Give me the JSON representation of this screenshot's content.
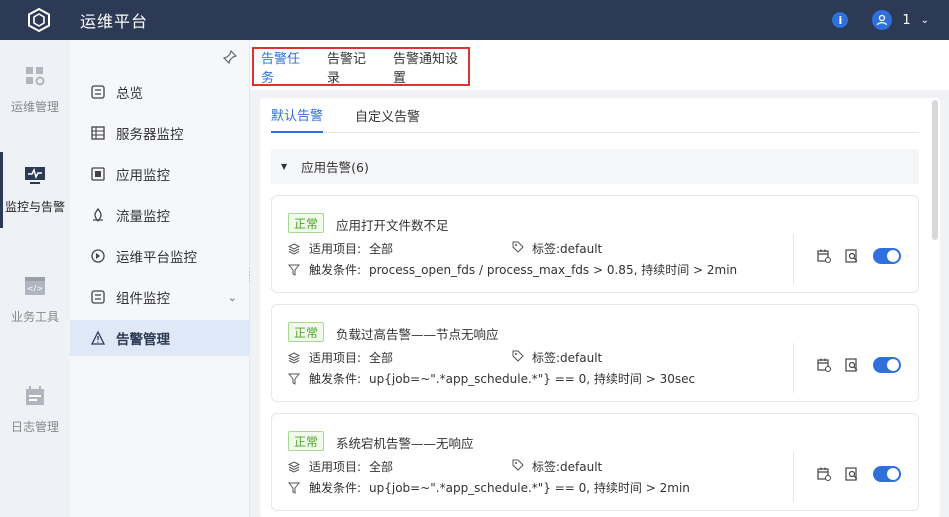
{
  "header": {
    "title": "运维平台",
    "user": "1",
    "icons": [
      "logo-cube-icon",
      "info-icon",
      "user-avatar-icon",
      "chevron-down-icon"
    ]
  },
  "rail": [
    {
      "label": "运维管理",
      "icon": "grid-gear-icon"
    },
    {
      "label": "监控与告警",
      "icon": "monitor-pulse-icon"
    },
    {
      "label": "业务工具",
      "icon": "code-window-icon"
    },
    {
      "label": "日志管理",
      "icon": "calendar-log-icon"
    }
  ],
  "submenu": [
    {
      "label": "总览",
      "icon": "overview-icon"
    },
    {
      "label": "服务器监控",
      "icon": "server-icon"
    },
    {
      "label": "应用监控",
      "icon": "app-icon"
    },
    {
      "label": "流量监控",
      "icon": "traffic-icon"
    },
    {
      "label": "运维平台监控",
      "icon": "platform-icon"
    },
    {
      "label": "组件监控",
      "icon": "component-icon"
    },
    {
      "label": "告警管理",
      "icon": "alarm-icon"
    }
  ],
  "top_tabs": [
    "告警任务",
    "告警记录",
    "告警通知设置"
  ],
  "inner_tabs": [
    "默认告警",
    "自定义告警"
  ],
  "group": {
    "label": "应用告警(6)"
  },
  "cards": [
    {
      "status": "正常",
      "title": "应用打开文件数不足",
      "project_label": "适用项目:",
      "project": "全部",
      "tag": "标签:default",
      "cond_label": "触发条件:",
      "cond": "process_open_fds / process_max_fds > 0.85, 持续时间 > 2min"
    },
    {
      "status": "正常",
      "title": "负载过高告警——节点无响应",
      "project_label": "适用项目:",
      "project": "全部",
      "tag": "标签:default",
      "cond_label": "触发条件:",
      "cond": "up{job=~\".*app_schedule.*\"} == 0, 持续时间 > 30sec"
    },
    {
      "status": "正常",
      "title": "系统宕机告警——无响应",
      "project_label": "适用项目:",
      "project": "全部",
      "tag": "标签:default",
      "cond_label": "触发条件:",
      "cond": "up{job=~\".*app_schedule.*\"} == 0, 持续时间 > 2min"
    }
  ],
  "colors": {
    "header_bg": "#2c3a56",
    "accent": "#2f6fde",
    "ok_green": "#52a12d",
    "highlight_red": "#e03030"
  }
}
